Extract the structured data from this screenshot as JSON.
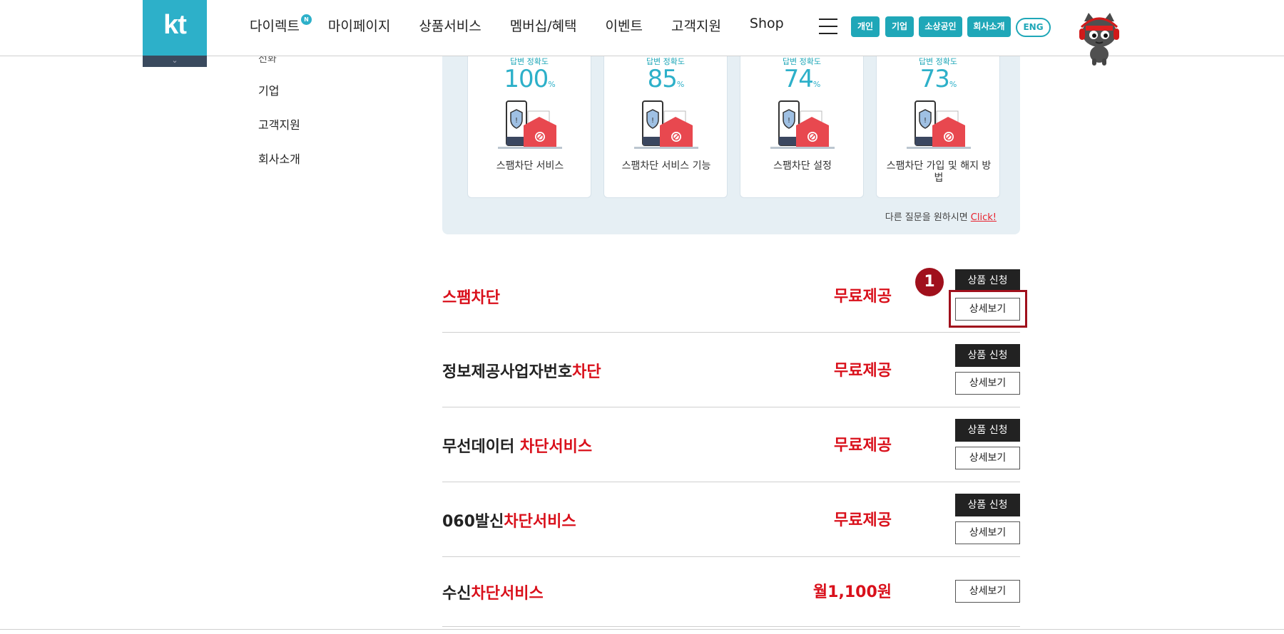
{
  "header": {
    "logo": "kt",
    "nav": [
      {
        "label": "다이렉트",
        "badge": "N"
      },
      {
        "label": "마이페이지"
      },
      {
        "label": "상품서비스"
      },
      {
        "label": "멤버십/혜택"
      },
      {
        "label": "이벤트"
      },
      {
        "label": "고객지원"
      },
      {
        "label": "Shop"
      }
    ],
    "segments": [
      "개인",
      "기업",
      "소상공인",
      "회사소개"
    ],
    "eng": "ENG"
  },
  "sidebar": {
    "items": [
      "전화",
      "기업",
      "고객지원",
      "회사소개"
    ]
  },
  "faq": {
    "accuracy_label": "답변 정확도",
    "unit": "%",
    "cards": [
      {
        "accuracy": "100",
        "title": "스팸차단 서비스"
      },
      {
        "accuracy": "85",
        "title": "스팸차단 서비스 기능"
      },
      {
        "accuracy": "74",
        "title": "스팸차단 설정"
      },
      {
        "accuracy": "73",
        "title": "스팸차단 가입 및 해지 방법"
      }
    ],
    "more_text": "다른 질문을 원하시면",
    "more_link": "Click!"
  },
  "products": [
    {
      "name_black": "",
      "name_red": "스팸차단",
      "price": "무료제공",
      "apply": "상품 신청",
      "detail": "상세보기"
    },
    {
      "name_black": "정보제공사업자번호",
      "name_red": "차단",
      "price": "무료제공",
      "apply": "상품 신청",
      "detail": "상세보기"
    },
    {
      "name_black": "무선데이터 ",
      "name_red": "차단서비스",
      "price": "무료제공",
      "apply": "상품 신청",
      "detail": "상세보기"
    },
    {
      "name_black": "060발신",
      "name_red": "차단서비스",
      "price": "무료제공",
      "apply": "상품 신청",
      "detail": "상세보기"
    },
    {
      "name_black": "수신",
      "name_red": "차단서비스",
      "price": "월1,100원",
      "detail": "상세보기"
    }
  ],
  "annotation": {
    "step": "1"
  },
  "colors": {
    "brand": "#2db0c9",
    "accent_red": "#d9101b",
    "highlight": "#a0101c"
  }
}
